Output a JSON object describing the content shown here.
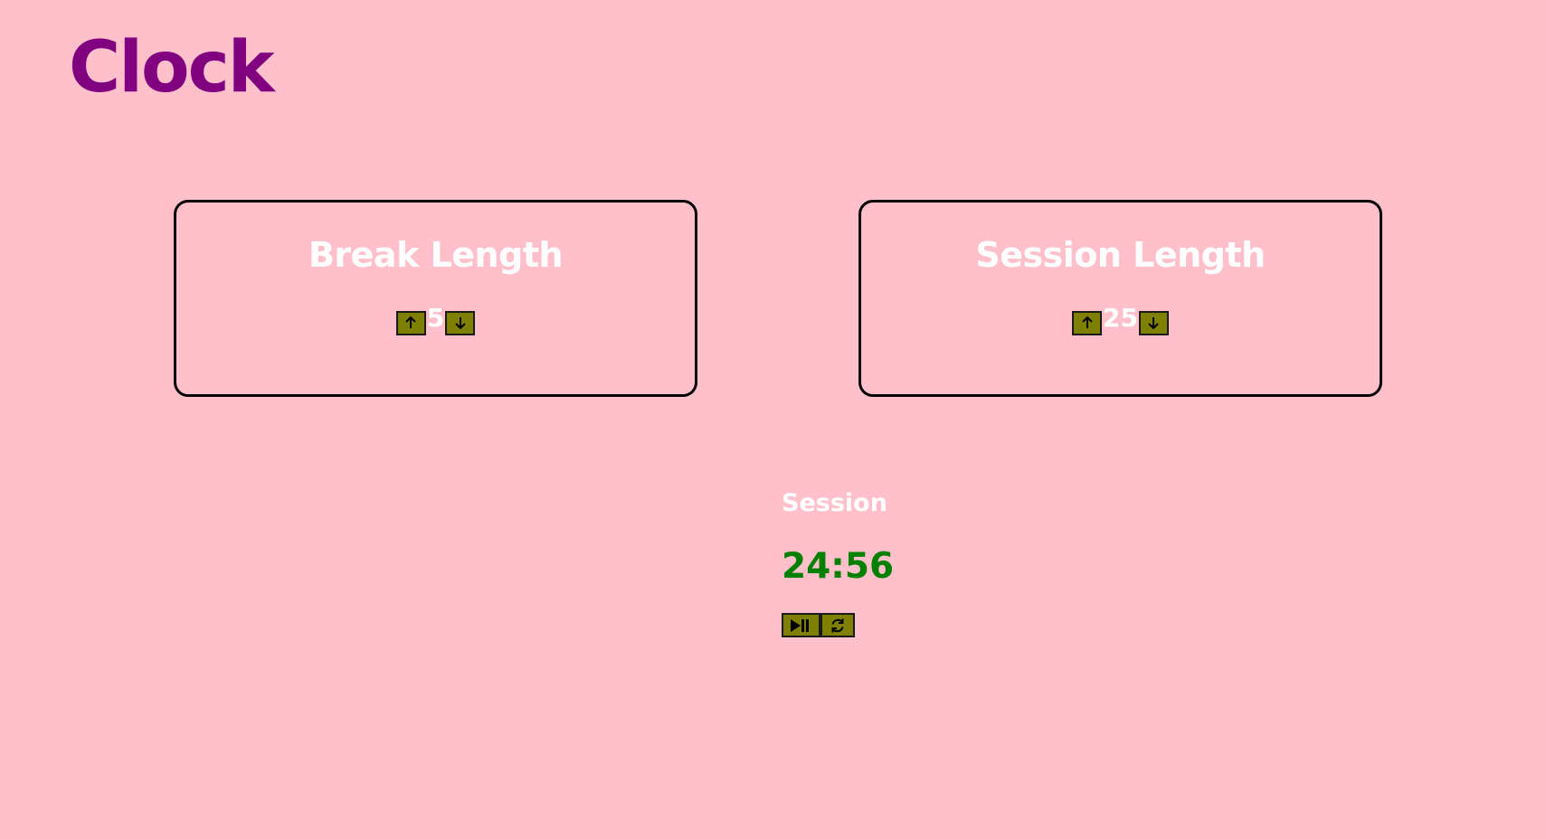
{
  "app": {
    "title": "Clock"
  },
  "break": {
    "label": "Break Length",
    "value": "5",
    "increment_icon": "arrow-up-icon",
    "decrement_icon": "arrow-down-icon"
  },
  "session": {
    "label": "Session Length",
    "value": "25",
    "increment_icon": "arrow-up-icon",
    "decrement_icon": "arrow-down-icon"
  },
  "timer": {
    "label": "Session",
    "time_left": "24:56",
    "start_stop_icon": "play-pause-icon",
    "reset_icon": "refresh-icon"
  },
  "colors": {
    "background": "#ffc0cb",
    "title": "#800080",
    "button": "#808000",
    "time": "#008000",
    "text": "#ffffff"
  }
}
